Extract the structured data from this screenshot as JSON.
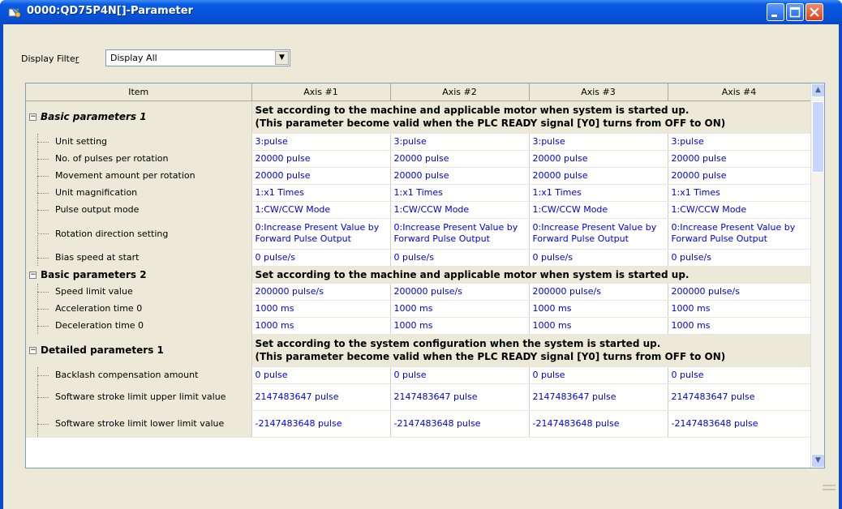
{
  "window": {
    "title": "0000:QD75P4N[]-Parameter"
  },
  "filter": {
    "label_pre": "Display Filte",
    "label_u": "r",
    "value": "Display All"
  },
  "columns": [
    "Item",
    "Axis #1",
    "Axis #2",
    "Axis #3",
    "Axis #4"
  ],
  "groups": [
    {
      "name": "Basic parameters 1",
      "italic": true,
      "desc": [
        "Set according to the machine and applicable motor when system is started up.",
        "(This parameter become valid when the PLC READY signal [Y0] turns from OFF to ON)"
      ],
      "rows": [
        {
          "label": "Unit setting",
          "values": [
            "3:pulse",
            "3:pulse",
            "3:pulse",
            "3:pulse"
          ]
        },
        {
          "label": "No. of pulses per rotation",
          "values": [
            "20000 pulse",
            "20000 pulse",
            "20000 pulse",
            "20000 pulse"
          ]
        },
        {
          "label": "Movement amount per rotation",
          "values": [
            "20000 pulse",
            "20000 pulse",
            "20000 pulse",
            "20000 pulse"
          ]
        },
        {
          "label": "Unit magnification",
          "values": [
            "1:x1 Times",
            "1:x1 Times",
            "1:x1 Times",
            "1:x1 Times"
          ]
        },
        {
          "label": "Pulse output mode",
          "values": [
            "1:CW/CCW Mode",
            "1:CW/CCW Mode",
            "1:CW/CCW Mode",
            "1:CW/CCW Mode"
          ]
        },
        {
          "label": "Rotation direction setting",
          "values": [
            "0:Increase Present Value by Forward Pulse Output",
            "0:Increase Present Value by Forward Pulse Output",
            "0:Increase Present Value by Forward Pulse Output",
            "0:Increase Present Value by Forward Pulse Output"
          ],
          "two_line": true
        },
        {
          "label": "Bias speed at start",
          "values": [
            "0 pulse/s",
            "0 pulse/s",
            "0 pulse/s",
            "0 pulse/s"
          ]
        }
      ]
    },
    {
      "name": "Basic parameters 2",
      "italic": false,
      "desc": [
        "Set according to the machine and applicable motor when system is started up."
      ],
      "rows": [
        {
          "label": "Speed limit value",
          "values": [
            "200000 pulse/s",
            "200000 pulse/s",
            "200000 pulse/s",
            "200000 pulse/s"
          ]
        },
        {
          "label": "Acceleration time 0",
          "values": [
            "1000 ms",
            "1000 ms",
            "1000 ms",
            "1000 ms"
          ]
        },
        {
          "label": "Deceleration time 0",
          "values": [
            "1000 ms",
            "1000 ms",
            "1000 ms",
            "1000 ms"
          ]
        }
      ]
    },
    {
      "name": "Detailed parameters 1",
      "italic": false,
      "desc": [
        "Set according to the system configuration when the system is started up.",
        "(This parameter become valid when the PLC READY signal [Y0] turns from OFF to ON)"
      ],
      "rows": [
        {
          "label": "Backlash compensation amount",
          "values": [
            "0 pulse",
            "0 pulse",
            "0 pulse",
            "0 pulse"
          ]
        },
        {
          "label": "Software stroke limit upper limit value",
          "values": [
            "2147483647 pulse",
            "2147483647 pulse",
            "2147483647 pulse",
            "2147483647 pulse"
          ],
          "tall": true
        },
        {
          "label": "Software stroke limit lower limit value",
          "values": [
            "-2147483648 pulse",
            "-2147483648 pulse",
            "-2147483648 pulse",
            "-2147483648 pulse"
          ],
          "tall": true
        }
      ]
    }
  ],
  "colors": {
    "value_text": "#0000d8",
    "titlebar": "#0a5ae2"
  }
}
